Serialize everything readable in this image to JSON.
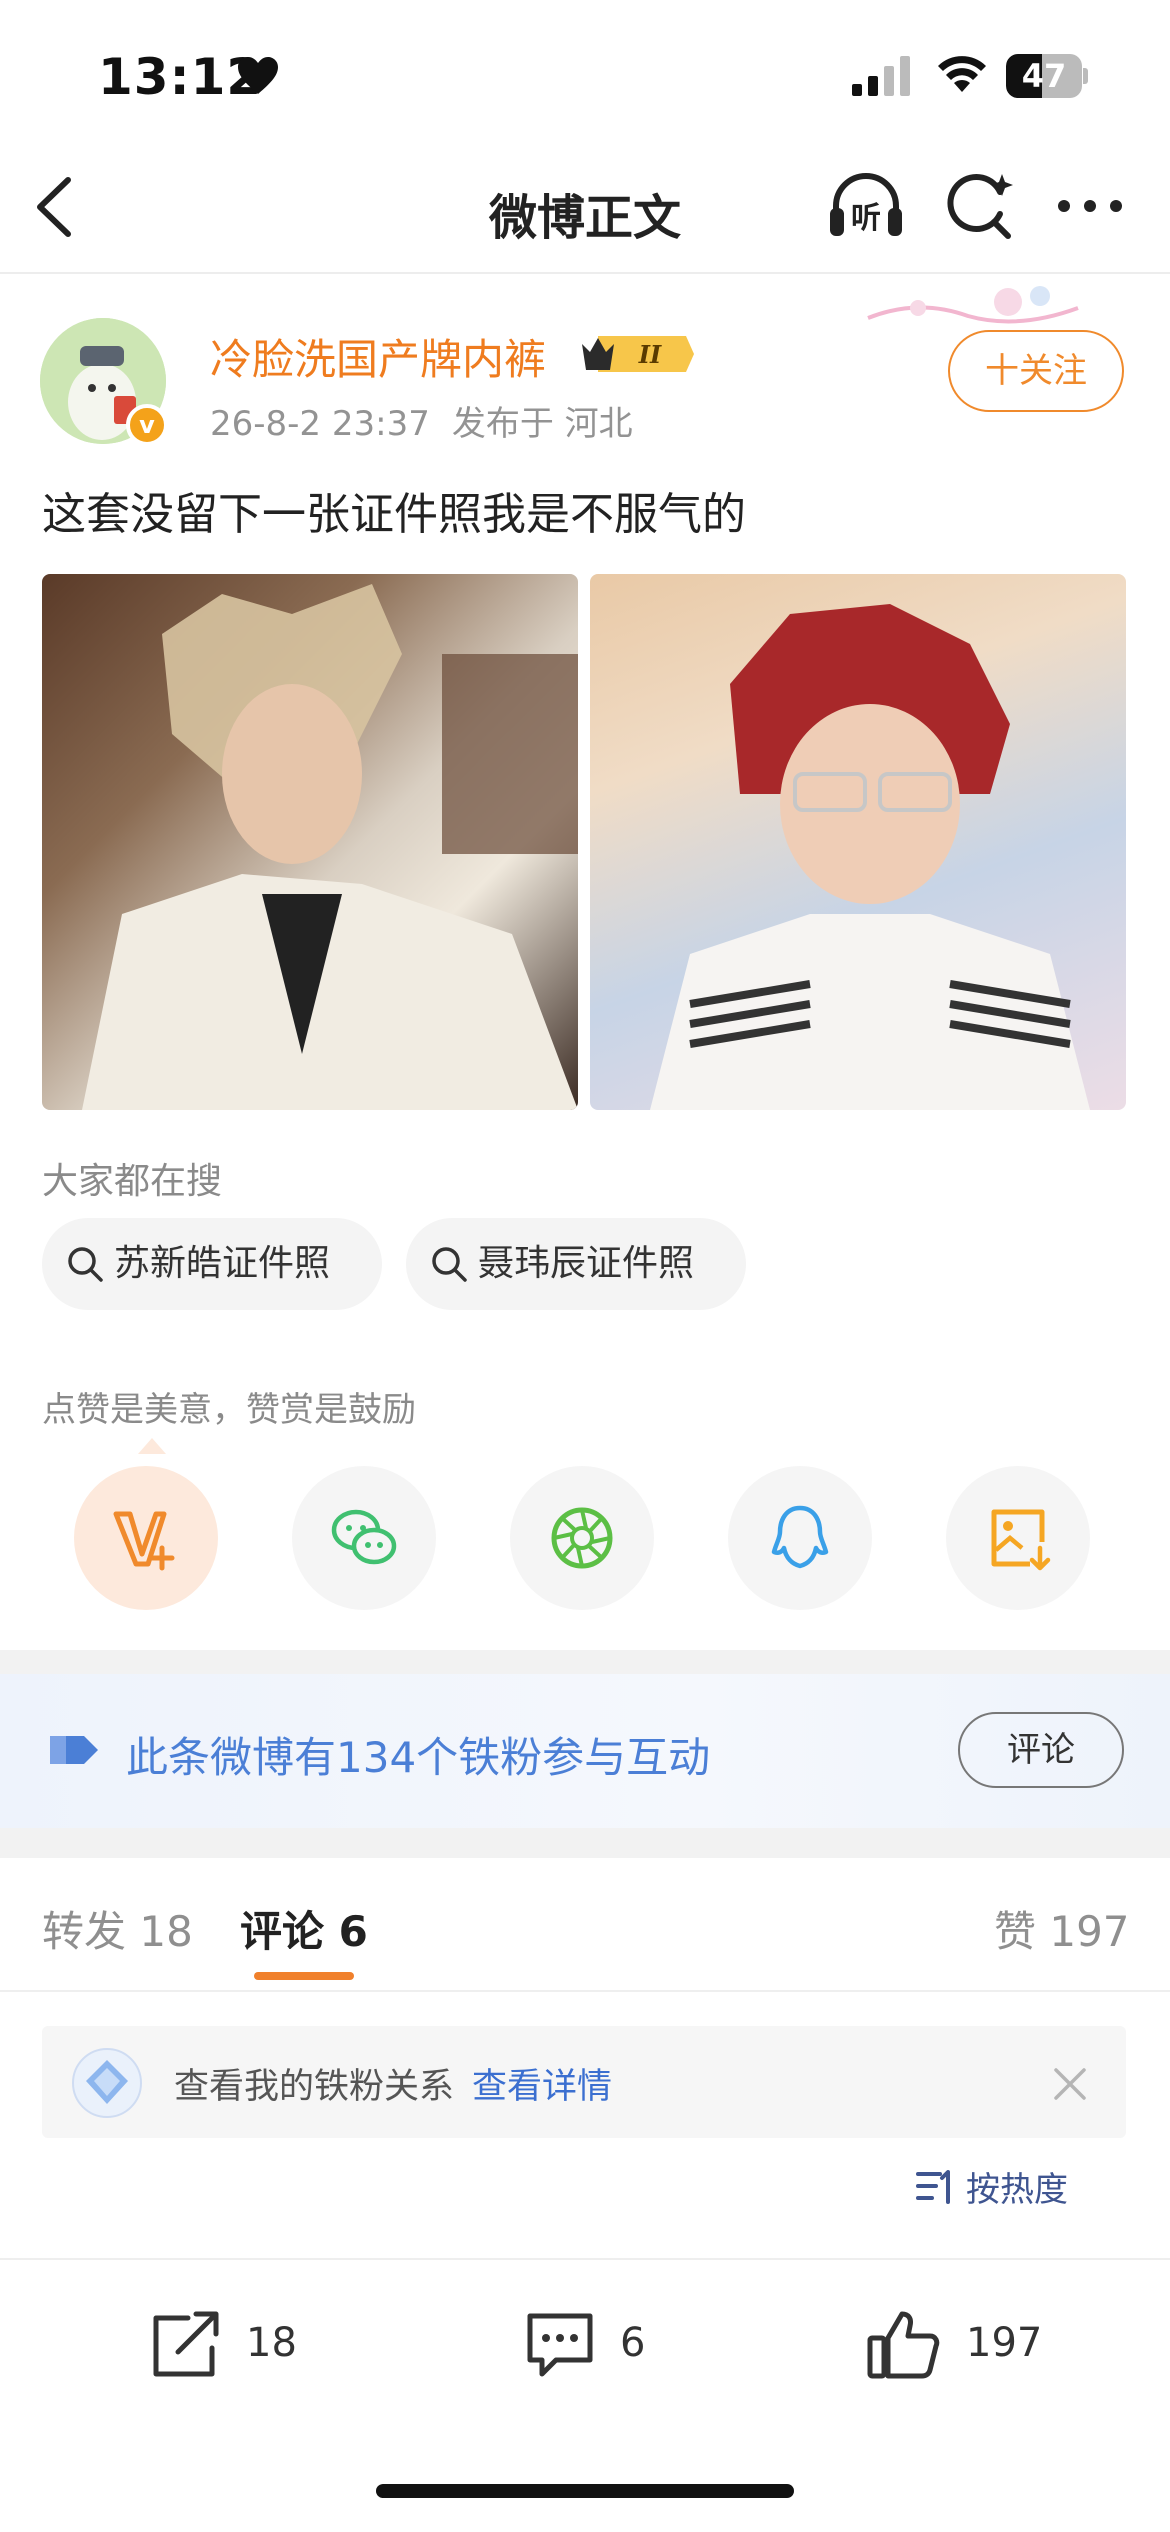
{
  "status_bar": {
    "time": "13:12",
    "battery": "47",
    "battery_level": 0.47,
    "icons": [
      "heart-icon",
      "signal-icon",
      "wifi-icon",
      "battery-icon"
    ]
  },
  "nav": {
    "title": "微博正文",
    "listen_label": "听",
    "icons": [
      "back-icon",
      "listen-icon",
      "search-icon",
      "more-icon"
    ]
  },
  "post": {
    "username": "冷脸洗国产牌内裤",
    "vip_level": "II",
    "verified_badge": "v",
    "time": "26-8-2 23:37",
    "location": "发布于 河北",
    "follow_label": "十关注",
    "text": "这套没留下一张证件照我是不服气的",
    "photos": [
      "photo-1",
      "photo-2"
    ]
  },
  "searches": {
    "label": "大家都在搜",
    "items": [
      "苏新皓证件照",
      "聂玮辰证件照"
    ]
  },
  "praise": {
    "label": "点赞是美意，赞赏是鼓励",
    "share_targets": [
      "reward-icon",
      "wechat-icon",
      "moments-icon",
      "qq-icon",
      "save-image-icon"
    ]
  },
  "fans_banner": {
    "text": "此条微博有134个铁粉参与互动",
    "button": "评论"
  },
  "tabs": {
    "repost": "转发 18",
    "comment": "评论 6",
    "like": "赞 197"
  },
  "relation": {
    "text": "查看我的铁粉关系",
    "link": "查看详情"
  },
  "sort": {
    "label": "按热度"
  },
  "bottom_bar": {
    "repost_count": "18",
    "comment_count": "6",
    "like_count": "197"
  },
  "colors": {
    "accent_orange": "#ef7c1f",
    "link_blue": "#3b6fd0",
    "banner_blue": "#4b7fd6",
    "wechat_green": "#40c070",
    "qq_blue": "#3aa0e8"
  }
}
